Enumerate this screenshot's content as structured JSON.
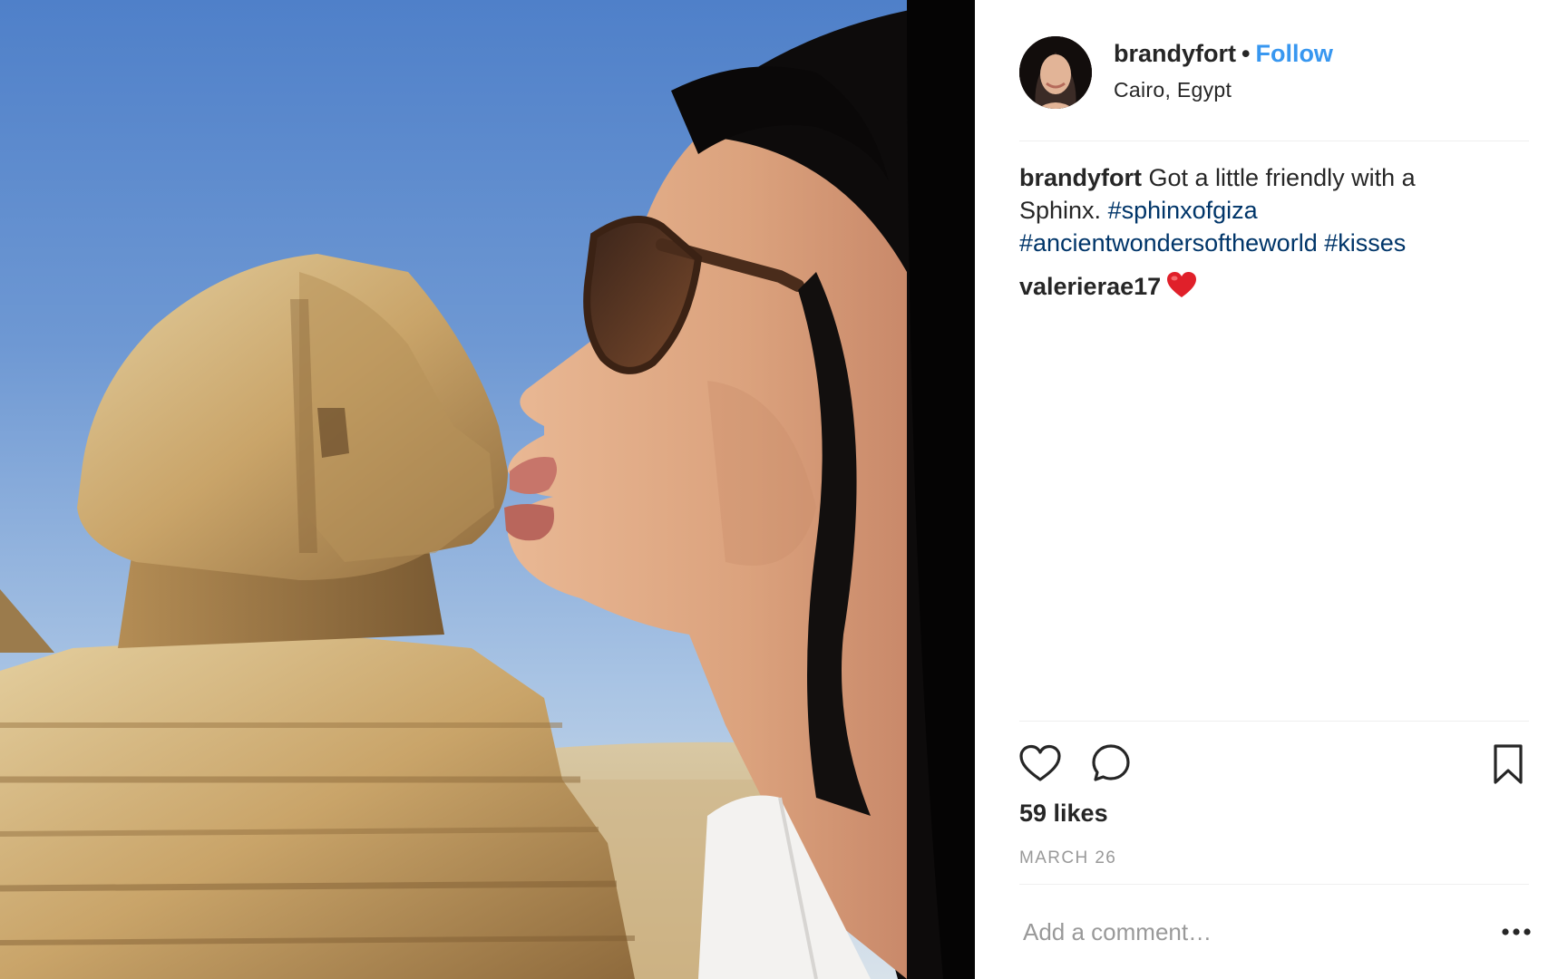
{
  "post": {
    "owner": {
      "username": "brandyfort",
      "separator": "•",
      "follow_label": "Follow",
      "location": "Cairo, Egypt"
    },
    "caption": {
      "username": "brandyfort",
      "text": " Got a little friendly with a Sphinx. ",
      "hashtags": [
        "#sphinxofgiza",
        "#ancientwondersoftheworld",
        "#kisses"
      ]
    },
    "comments": [
      {
        "username": "valerierae17",
        "emoji": "heart"
      }
    ],
    "likes_label": "59 likes",
    "date_label": "MARCH 26",
    "comment_input": {
      "placeholder": "Add a comment…",
      "value": ""
    },
    "icons": {
      "like": "heart-outline-icon",
      "comment": "speech-bubble-icon",
      "save": "bookmark-icon",
      "more": "ellipsis-icon"
    },
    "colors": {
      "follow": "#3897f0",
      "hashtag": "#003569",
      "muted": "#999999",
      "text": "#262626",
      "heart_emoji": "#e0202a"
    }
  }
}
